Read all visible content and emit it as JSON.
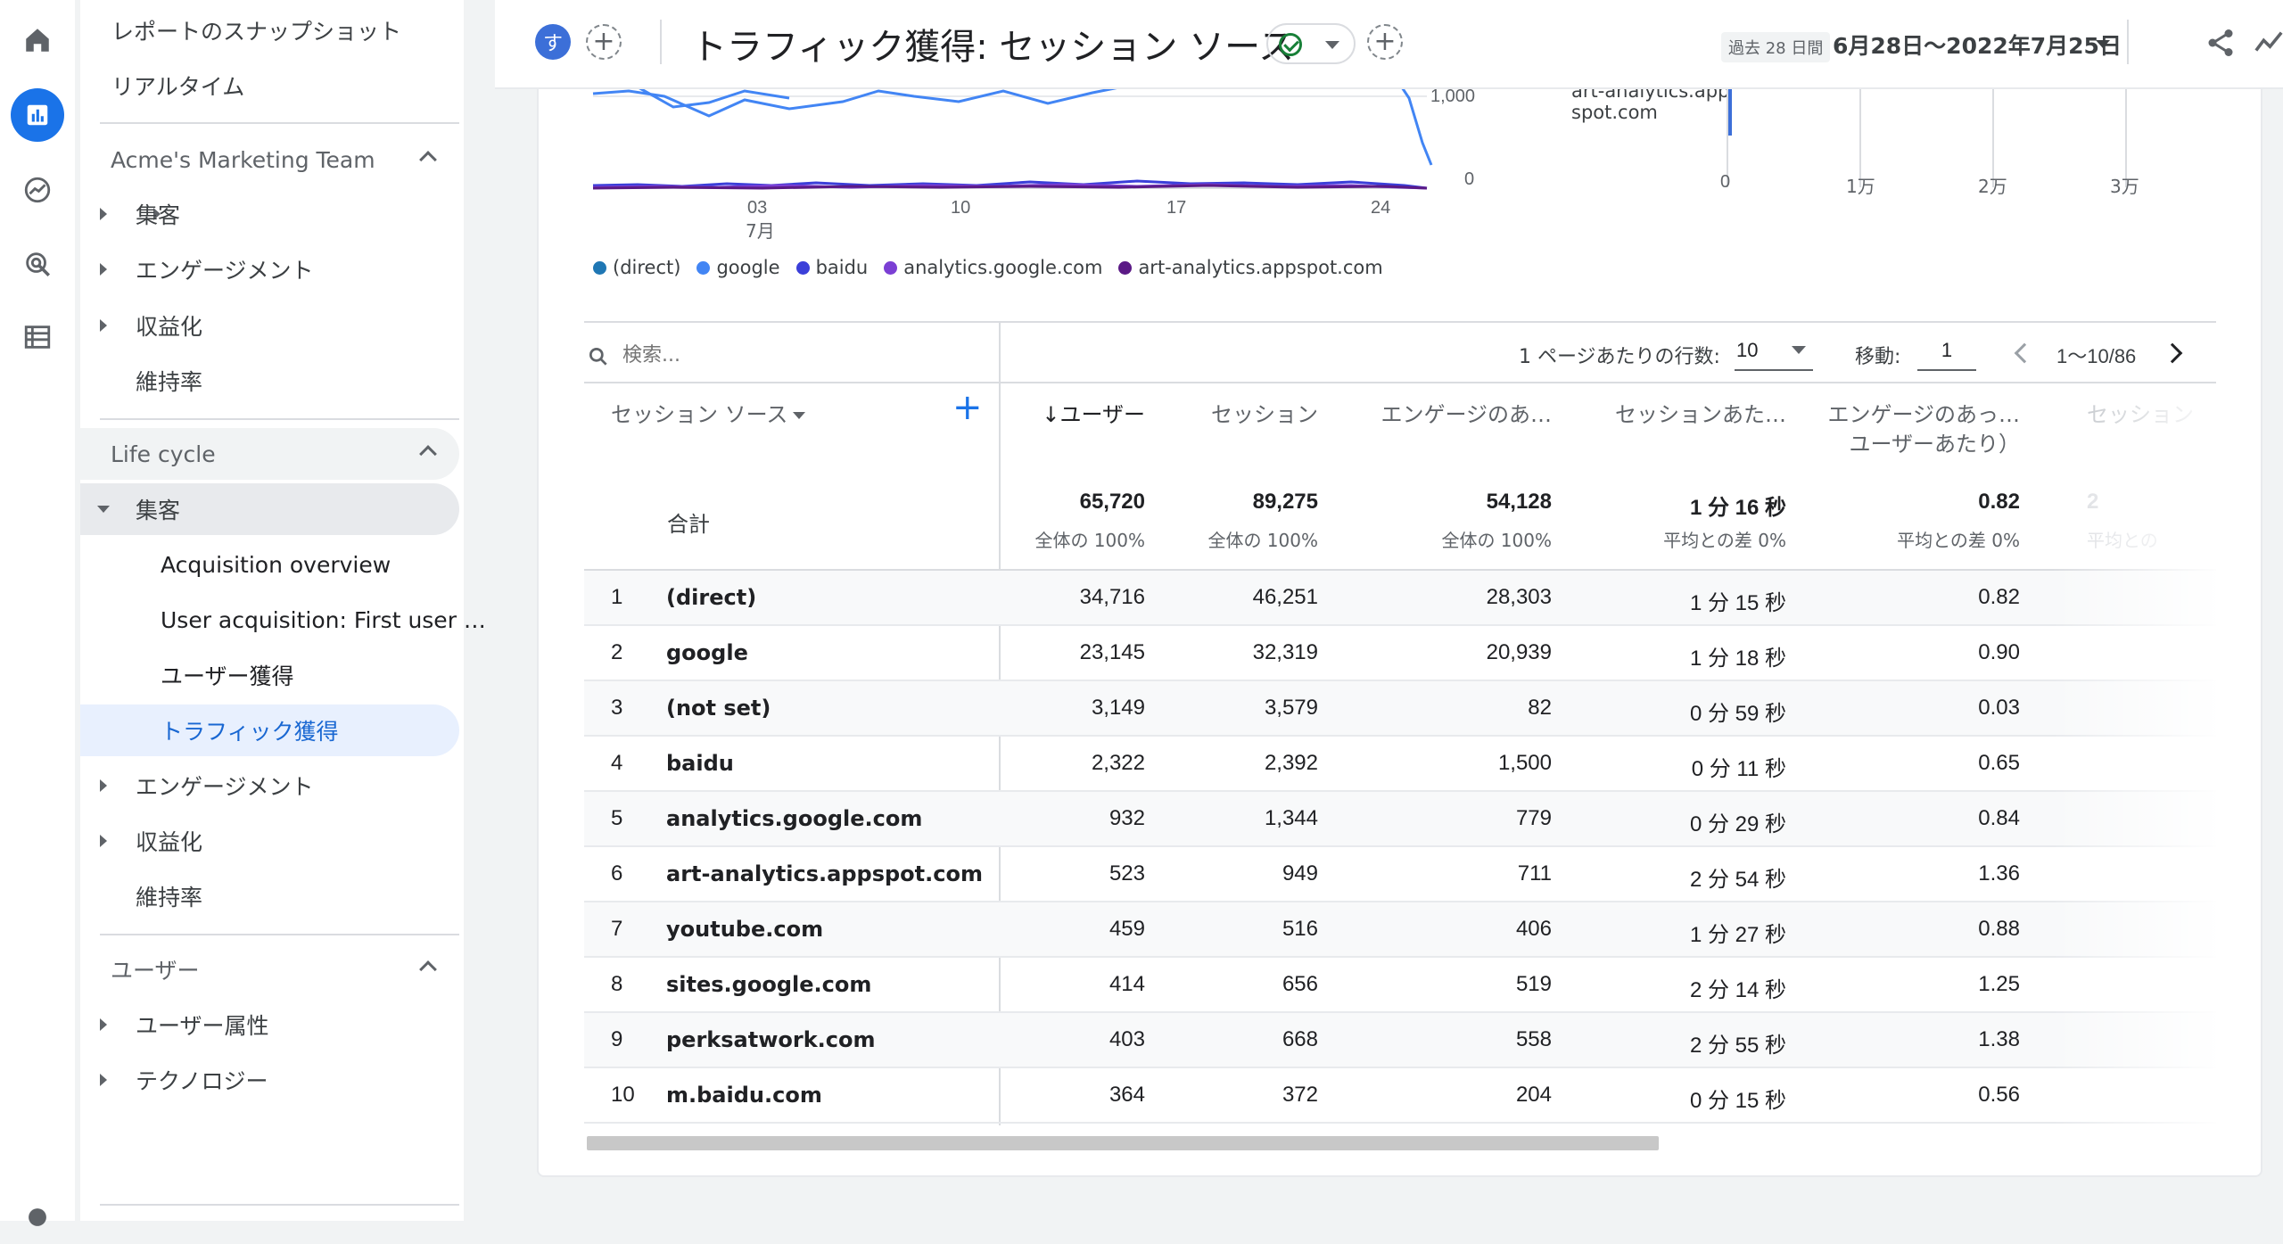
{
  "sidebar": {
    "top_items": [
      "レポートのスナップショット",
      "リアルタイム"
    ],
    "sections": [
      {
        "title": "Acme's Marketing Team",
        "items": [
          "集客",
          "エンゲージメント",
          "収益化",
          "維持率"
        ]
      },
      {
        "title": "Life cycle",
        "items": [
          "集客",
          "エンゲージメント",
          "収益化",
          "維持率"
        ],
        "sub_items": [
          "Acquisition overview",
          "User acquisition: First user …",
          "ユーザー獲得",
          "トラフィック獲得"
        ]
      },
      {
        "title": "ユーザー",
        "items": [
          "ユーザー属性",
          "テクノロジー"
        ]
      }
    ]
  },
  "header": {
    "avatar_letter": "す",
    "title": "トラフィック獲得: セッション ソース",
    "date_tag": "過去 28 日間",
    "date_range": "6月28日～2022年7月25日"
  },
  "chart": {
    "y_ticks": [
      "1,000",
      "0"
    ],
    "x_ticks": [
      "03",
      "10",
      "17",
      "24"
    ],
    "x_month": "7月",
    "legend": [
      {
        "label": "(direct)",
        "color": "#1f77b4"
      },
      {
        "label": "google",
        "color": "#4285f4"
      },
      {
        "label": "baidu",
        "color": "#3b3fd9"
      },
      {
        "label": "analytics.google.com",
        "color": "#7b3fd4"
      },
      {
        "label": "art-analytics.appspot.com",
        "color": "#5b1a86"
      }
    ],
    "bar_label_1": "art-analytics.app",
    "bar_label_2": "spot.com",
    "bar_x_ticks": [
      "0",
      "1万",
      "2万",
      "3万"
    ]
  },
  "chart_data": {
    "type": "line",
    "x": [
      "03",
      "10",
      "17",
      "24"
    ],
    "ylim": [
      0,
      1000
    ],
    "series": [
      {
        "name": "(direct)"
      },
      {
        "name": "google"
      },
      {
        "name": "baidu"
      },
      {
        "name": "analytics.google.com"
      },
      {
        "name": "art-analytics.appspot.com"
      }
    ]
  },
  "table": {
    "search_placeholder": "検索...",
    "rows_per_page_label": "1 ページあたりの行数:",
    "rows_per_page": "10",
    "goto_label": "移動:",
    "goto_value": "1",
    "page_range": "1～10/86",
    "dimension_header": "セッション ソース",
    "columns": [
      "↓ユーザー",
      "セッション",
      "エンゲージのあ…",
      "セッションあた…",
      "エンゲージのあっ…",
      "セッション"
    ],
    "column_sub": "ユーザーあたり）",
    "total_label": "合計",
    "totals": [
      {
        "value": "65,720",
        "sub": "全体の 100%"
      },
      {
        "value": "89,275",
        "sub": "全体の 100%"
      },
      {
        "value": "54,128",
        "sub": "全体の 100%"
      },
      {
        "value": "1 分 16 秒",
        "sub": "平均との差 0%"
      },
      {
        "value": "0.82",
        "sub": "平均との差 0%"
      },
      {
        "value": "2",
        "sub": "平均との"
      }
    ],
    "rows": [
      {
        "n": "1",
        "source": "(direct)",
        "users": "34,716",
        "sessions": "46,251",
        "engaged": "28,303",
        "avg": "1 分 15 秒",
        "eng_per_user": "0.82"
      },
      {
        "n": "2",
        "source": "google",
        "users": "23,145",
        "sessions": "32,319",
        "engaged": "20,939",
        "avg": "1 分 18 秒",
        "eng_per_user": "0.90"
      },
      {
        "n": "3",
        "source": "(not set)",
        "users": "3,149",
        "sessions": "3,579",
        "engaged": "82",
        "avg": "0 分 59 秒",
        "eng_per_user": "0.03"
      },
      {
        "n": "4",
        "source": "baidu",
        "users": "2,322",
        "sessions": "2,392",
        "engaged": "1,500",
        "avg": "0 分 11 秒",
        "eng_per_user": "0.65"
      },
      {
        "n": "5",
        "source": "analytics.google.com",
        "users": "932",
        "sessions": "1,344",
        "engaged": "779",
        "avg": "0 分 29 秒",
        "eng_per_user": "0.84"
      },
      {
        "n": "6",
        "source": "art-analytics.appspot.com",
        "users": "523",
        "sessions": "949",
        "engaged": "711",
        "avg": "2 分 54 秒",
        "eng_per_user": "1.36"
      },
      {
        "n": "7",
        "source": "youtube.com",
        "users": "459",
        "sessions": "516",
        "engaged": "406",
        "avg": "1 分 27 秒",
        "eng_per_user": "0.88"
      },
      {
        "n": "8",
        "source": "sites.google.com",
        "users": "414",
        "sessions": "656",
        "engaged": "519",
        "avg": "2 分 14 秒",
        "eng_per_user": "1.25"
      },
      {
        "n": "9",
        "source": "perksatwork.com",
        "users": "403",
        "sessions": "668",
        "engaged": "558",
        "avg": "2 分 55 秒",
        "eng_per_user": "1.38"
      },
      {
        "n": "10",
        "source": "m.baidu.com",
        "users": "364",
        "sessions": "372",
        "engaged": "204",
        "avg": "0 分 15 秒",
        "eng_per_user": "0.56"
      }
    ]
  }
}
